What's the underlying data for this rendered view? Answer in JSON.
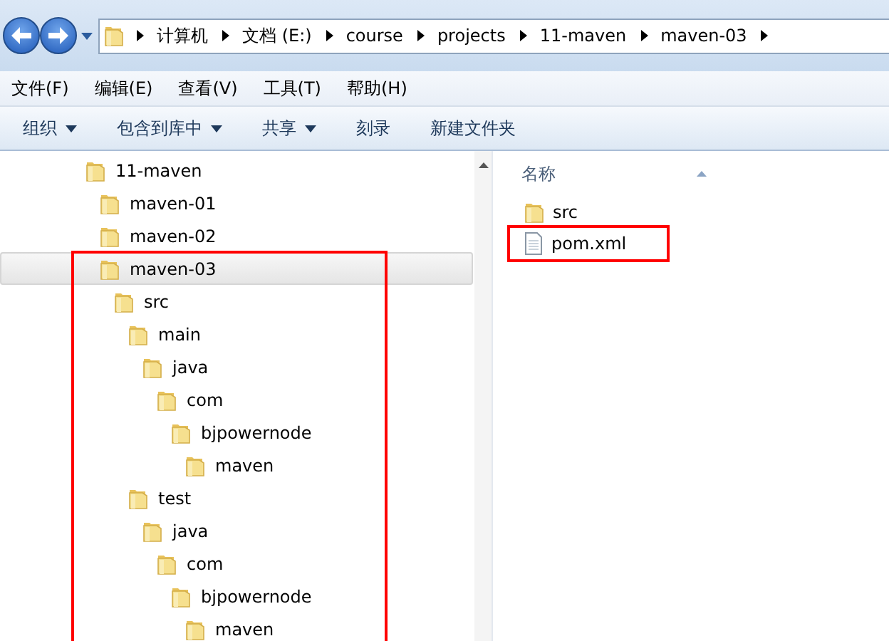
{
  "address": {
    "segments": [
      "计算机",
      "文档 (E:)",
      "course",
      "projects",
      "11-maven",
      "maven-03"
    ]
  },
  "menu": [
    "文件(F)",
    "编辑(E)",
    "查看(V)",
    "工具(T)",
    "帮助(H)"
  ],
  "toolbar": [
    {
      "label": "组织",
      "dropdown": true
    },
    {
      "label": "包含到库中",
      "dropdown": true
    },
    {
      "label": "共享",
      "dropdown": true
    },
    {
      "label": "刻录",
      "dropdown": false
    },
    {
      "label": "新建文件夹",
      "dropdown": false
    }
  ],
  "tree": [
    {
      "label": "11-maven",
      "selected": false,
      "marked": false,
      "children": [
        {
          "label": "maven-01",
          "selected": false,
          "marked": false
        },
        {
          "label": "maven-02",
          "selected": false,
          "marked": false
        },
        {
          "label": "maven-03",
          "selected": true,
          "marked": true,
          "children": [
            {
              "label": "src",
              "selected": false,
              "marked": false,
              "children": [
                {
                  "label": "main",
                  "selected": false,
                  "marked": false,
                  "children": [
                    {
                      "label": "java",
                      "selected": false,
                      "marked": false,
                      "children": [
                        {
                          "label": "com",
                          "selected": false,
                          "marked": false,
                          "children": [
                            {
                              "label": "bjpowernode",
                              "selected": false,
                              "marked": false,
                              "children": [
                                {
                                  "label": "maven",
                                  "selected": false,
                                  "marked": false
                                }
                              ]
                            }
                          ]
                        }
                      ]
                    }
                  ]
                },
                {
                  "label": "test",
                  "selected": false,
                  "marked": false,
                  "children": [
                    {
                      "label": "java",
                      "selected": false,
                      "marked": false,
                      "children": [
                        {
                          "label": "com",
                          "selected": false,
                          "marked": false,
                          "children": [
                            {
                              "label": "bjpowernode",
                              "selected": false,
                              "marked": false,
                              "children": [
                                {
                                  "label": "maven",
                                  "selected": false,
                                  "marked": false
                                }
                              ]
                            }
                          ]
                        }
                      ]
                    }
                  ]
                }
              ]
            }
          ]
        }
      ]
    }
  ],
  "file_list": {
    "column": "名称",
    "items": [
      {
        "name": "src",
        "kind": "folder",
        "marked": false
      },
      {
        "name": "pom.xml",
        "kind": "file",
        "marked": true
      }
    ]
  }
}
